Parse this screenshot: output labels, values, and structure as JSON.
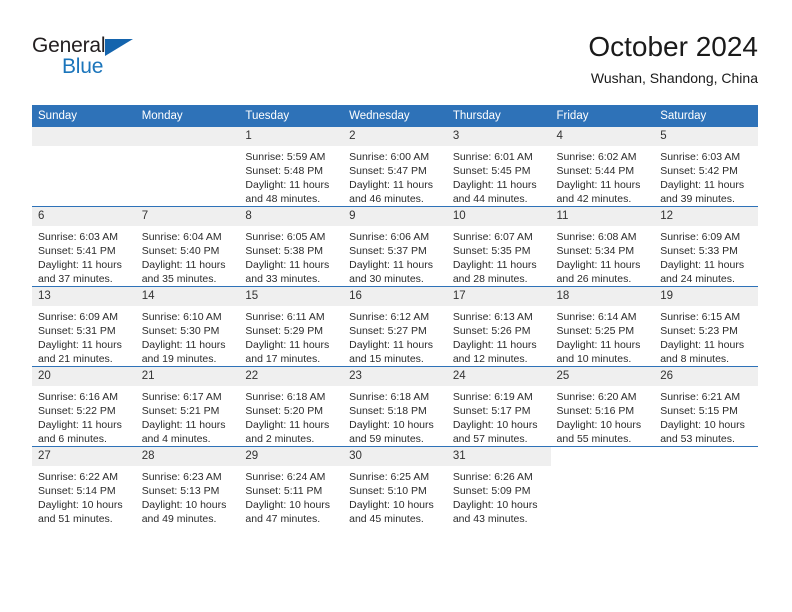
{
  "brand": {
    "name_dark": "General",
    "name_light": "Blue",
    "triangle_color": "#1464ad",
    "blue_color": "#1b75bb"
  },
  "header": {
    "month_title": "October 2024",
    "location": "Wushan, Shandong, China"
  },
  "theme": {
    "header_blue": "#2e72b8",
    "daynum_band": "#efefef",
    "text": "#2b2b2b"
  },
  "calendar": {
    "weekday_headers": [
      "Sunday",
      "Monday",
      "Tuesday",
      "Wednesday",
      "Thursday",
      "Friday",
      "Saturday"
    ],
    "weeks": [
      [
        {
          "kind": "empty",
          "day": "",
          "sunrise": "",
          "sunset": "",
          "daylight1": "",
          "daylight2": ""
        },
        {
          "kind": "empty",
          "day": "",
          "sunrise": "",
          "sunset": "",
          "daylight1": "",
          "daylight2": ""
        },
        {
          "kind": "day",
          "day": "1",
          "sunrise": "Sunrise: 5:59 AM",
          "sunset": "Sunset: 5:48 PM",
          "daylight1": "Daylight: 11 hours",
          "daylight2": "and 48 minutes."
        },
        {
          "kind": "day",
          "day": "2",
          "sunrise": "Sunrise: 6:00 AM",
          "sunset": "Sunset: 5:47 PM",
          "daylight1": "Daylight: 11 hours",
          "daylight2": "and 46 minutes."
        },
        {
          "kind": "day",
          "day": "3",
          "sunrise": "Sunrise: 6:01 AM",
          "sunset": "Sunset: 5:45 PM",
          "daylight1": "Daylight: 11 hours",
          "daylight2": "and 44 minutes."
        },
        {
          "kind": "day",
          "day": "4",
          "sunrise": "Sunrise: 6:02 AM",
          "sunset": "Sunset: 5:44 PM",
          "daylight1": "Daylight: 11 hours",
          "daylight2": "and 42 minutes."
        },
        {
          "kind": "day",
          "day": "5",
          "sunrise": "Sunrise: 6:03 AM",
          "sunset": "Sunset: 5:42 PM",
          "daylight1": "Daylight: 11 hours",
          "daylight2": "and 39 minutes."
        }
      ],
      [
        {
          "kind": "day",
          "day": "6",
          "sunrise": "Sunrise: 6:03 AM",
          "sunset": "Sunset: 5:41 PM",
          "daylight1": "Daylight: 11 hours",
          "daylight2": "and 37 minutes."
        },
        {
          "kind": "day",
          "day": "7",
          "sunrise": "Sunrise: 6:04 AM",
          "sunset": "Sunset: 5:40 PM",
          "daylight1": "Daylight: 11 hours",
          "daylight2": "and 35 minutes."
        },
        {
          "kind": "day",
          "day": "8",
          "sunrise": "Sunrise: 6:05 AM",
          "sunset": "Sunset: 5:38 PM",
          "daylight1": "Daylight: 11 hours",
          "daylight2": "and 33 minutes."
        },
        {
          "kind": "day",
          "day": "9",
          "sunrise": "Sunrise: 6:06 AM",
          "sunset": "Sunset: 5:37 PM",
          "daylight1": "Daylight: 11 hours",
          "daylight2": "and 30 minutes."
        },
        {
          "kind": "day",
          "day": "10",
          "sunrise": "Sunrise: 6:07 AM",
          "sunset": "Sunset: 5:35 PM",
          "daylight1": "Daylight: 11 hours",
          "daylight2": "and 28 minutes."
        },
        {
          "kind": "day",
          "day": "11",
          "sunrise": "Sunrise: 6:08 AM",
          "sunset": "Sunset: 5:34 PM",
          "daylight1": "Daylight: 11 hours",
          "daylight2": "and 26 minutes."
        },
        {
          "kind": "day",
          "day": "12",
          "sunrise": "Sunrise: 6:09 AM",
          "sunset": "Sunset: 5:33 PM",
          "daylight1": "Daylight: 11 hours",
          "daylight2": "and 24 minutes."
        }
      ],
      [
        {
          "kind": "day",
          "day": "13",
          "sunrise": "Sunrise: 6:09 AM",
          "sunset": "Sunset: 5:31 PM",
          "daylight1": "Daylight: 11 hours",
          "daylight2": "and 21 minutes."
        },
        {
          "kind": "day",
          "day": "14",
          "sunrise": "Sunrise: 6:10 AM",
          "sunset": "Sunset: 5:30 PM",
          "daylight1": "Daylight: 11 hours",
          "daylight2": "and 19 minutes."
        },
        {
          "kind": "day",
          "day": "15",
          "sunrise": "Sunrise: 6:11 AM",
          "sunset": "Sunset: 5:29 PM",
          "daylight1": "Daylight: 11 hours",
          "daylight2": "and 17 minutes."
        },
        {
          "kind": "day",
          "day": "16",
          "sunrise": "Sunrise: 6:12 AM",
          "sunset": "Sunset: 5:27 PM",
          "daylight1": "Daylight: 11 hours",
          "daylight2": "and 15 minutes."
        },
        {
          "kind": "day",
          "day": "17",
          "sunrise": "Sunrise: 6:13 AM",
          "sunset": "Sunset: 5:26 PM",
          "daylight1": "Daylight: 11 hours",
          "daylight2": "and 12 minutes."
        },
        {
          "kind": "day",
          "day": "18",
          "sunrise": "Sunrise: 6:14 AM",
          "sunset": "Sunset: 5:25 PM",
          "daylight1": "Daylight: 11 hours",
          "daylight2": "and 10 minutes."
        },
        {
          "kind": "day",
          "day": "19",
          "sunrise": "Sunrise: 6:15 AM",
          "sunset": "Sunset: 5:23 PM",
          "daylight1": "Daylight: 11 hours",
          "daylight2": "and 8 minutes."
        }
      ],
      [
        {
          "kind": "day",
          "day": "20",
          "sunrise": "Sunrise: 6:16 AM",
          "sunset": "Sunset: 5:22 PM",
          "daylight1": "Daylight: 11 hours",
          "daylight2": "and 6 minutes."
        },
        {
          "kind": "day",
          "day": "21",
          "sunrise": "Sunrise: 6:17 AM",
          "sunset": "Sunset: 5:21 PM",
          "daylight1": "Daylight: 11 hours",
          "daylight2": "and 4 minutes."
        },
        {
          "kind": "day",
          "day": "22",
          "sunrise": "Sunrise: 6:18 AM",
          "sunset": "Sunset: 5:20 PM",
          "daylight1": "Daylight: 11 hours",
          "daylight2": "and 2 minutes."
        },
        {
          "kind": "day",
          "day": "23",
          "sunrise": "Sunrise: 6:18 AM",
          "sunset": "Sunset: 5:18 PM",
          "daylight1": "Daylight: 10 hours",
          "daylight2": "and 59 minutes."
        },
        {
          "kind": "day",
          "day": "24",
          "sunrise": "Sunrise: 6:19 AM",
          "sunset": "Sunset: 5:17 PM",
          "daylight1": "Daylight: 10 hours",
          "daylight2": "and 57 minutes."
        },
        {
          "kind": "day",
          "day": "25",
          "sunrise": "Sunrise: 6:20 AM",
          "sunset": "Sunset: 5:16 PM",
          "daylight1": "Daylight: 10 hours",
          "daylight2": "and 55 minutes."
        },
        {
          "kind": "day",
          "day": "26",
          "sunrise": "Sunrise: 6:21 AM",
          "sunset": "Sunset: 5:15 PM",
          "daylight1": "Daylight: 10 hours",
          "daylight2": "and 53 minutes."
        }
      ],
      [
        {
          "kind": "day",
          "day": "27",
          "sunrise": "Sunrise: 6:22 AM",
          "sunset": "Sunset: 5:14 PM",
          "daylight1": "Daylight: 10 hours",
          "daylight2": "and 51 minutes."
        },
        {
          "kind": "day",
          "day": "28",
          "sunrise": "Sunrise: 6:23 AM",
          "sunset": "Sunset: 5:13 PM",
          "daylight1": "Daylight: 10 hours",
          "daylight2": "and 49 minutes."
        },
        {
          "kind": "day",
          "day": "29",
          "sunrise": "Sunrise: 6:24 AM",
          "sunset": "Sunset: 5:11 PM",
          "daylight1": "Daylight: 10 hours",
          "daylight2": "and 47 minutes."
        },
        {
          "kind": "day",
          "day": "30",
          "sunrise": "Sunrise: 6:25 AM",
          "sunset": "Sunset: 5:10 PM",
          "daylight1": "Daylight: 10 hours",
          "daylight2": "and 45 minutes."
        },
        {
          "kind": "day",
          "day": "31",
          "sunrise": "Sunrise: 6:26 AM",
          "sunset": "Sunset: 5:09 PM",
          "daylight1": "Daylight: 10 hours",
          "daylight2": "and 43 minutes."
        },
        {
          "kind": "blank",
          "day": "",
          "sunrise": "",
          "sunset": "",
          "daylight1": "",
          "daylight2": ""
        },
        {
          "kind": "blank",
          "day": "",
          "sunrise": "",
          "sunset": "",
          "daylight1": "",
          "daylight2": ""
        }
      ]
    ]
  }
}
